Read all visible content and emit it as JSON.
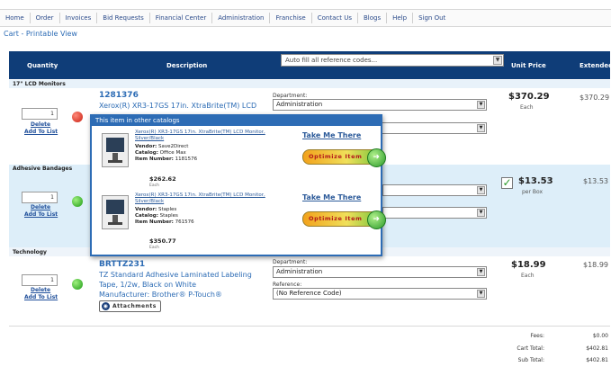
{
  "nav": [
    "Home",
    "Order",
    "Invoices",
    "Bid Requests",
    "Financial Center",
    "Administration",
    "Franchise",
    "Contact Us",
    "Blogs",
    "Help",
    "Sign Out"
  ],
  "breadcrumb": "Cart - Printable View",
  "header": {
    "quantity": "Quantity",
    "description": "Description",
    "autofill": "Auto fill all reference codes...",
    "unit_price": "Unit Price",
    "extended": "Extended"
  },
  "sections": {
    "lcd": "17\" LCD Monitors",
    "bandages": "Adhesive Bandages",
    "technology": "Technology"
  },
  "links": {
    "delete": "Delete",
    "add_to_list": "Add To List"
  },
  "item1": {
    "qty": "1",
    "number": "1281376",
    "desc": "Xerox(R) XR3-17GS 17in. XtraBrite(TM) LCD",
    "dept_label": "Department:",
    "dept": "Administration",
    "price": "$370.29",
    "unit": "Each",
    "extended": "$370.29",
    "status_color": "#c81e10"
  },
  "item2": {
    "qty": "1",
    "price": "$13.53",
    "unit": "per Box",
    "extended": "$13.53",
    "checked": "✓",
    "status_color": "#1c9a14"
  },
  "item3": {
    "qty": "1",
    "number": "BRTTZ231",
    "desc": "TZ Standard Adhesive Laminated Labeling Tape, 1/2w, Black on White",
    "manufacturer": "Manufacturer: Brother® P-Touch®",
    "attachments": "Attachments",
    "dept_label": "Department:",
    "dept": "Administration",
    "ref_label": "Reference:",
    "ref": "(No Reference Code)",
    "price": "$18.99",
    "unit": "Each",
    "extended": "$18.99",
    "status_color": "#1c9a14"
  },
  "popup": {
    "title": "This item in other catalogs",
    "items": [
      {
        "title": "Xerox(R) XR3-17GS 17in. XtraBrite(TM) LCD Monitor, Silver/Black",
        "vendor_label": "Vendor:",
        "vendor": "Save2Direct",
        "catalog_label": "Catalog:",
        "catalog": "Office Max",
        "item_label": "Item Number:",
        "item": "1181576",
        "price": "$262.62",
        "unit": "Each",
        "take_me": "Take Me There",
        "optimize": "Optimize Item"
      },
      {
        "title": "Xerox(R) XR3-17GS 17in. XtraBrite(TM) LCD Monitor, Silver/Black",
        "vendor_label": "Vendor:",
        "vendor": "Staples",
        "catalog_label": "Catalog:",
        "catalog": "Staples",
        "item_label": "Item Number:",
        "item": "761576",
        "price": "$350.77",
        "unit": "Each",
        "take_me": "Take Me There",
        "optimize": "Optimize Item"
      }
    ]
  },
  "totals": {
    "fees_label": "Fees:",
    "fees": "$0.00",
    "cart_label": "Cart Total:",
    "cart": "$402.81",
    "sub_label": "Sub Total:",
    "sub": "$402.81"
  },
  "colors": {
    "header": "#0f3d78",
    "link": "#2d6cb5",
    "row_highlight": "#ddeef9"
  }
}
